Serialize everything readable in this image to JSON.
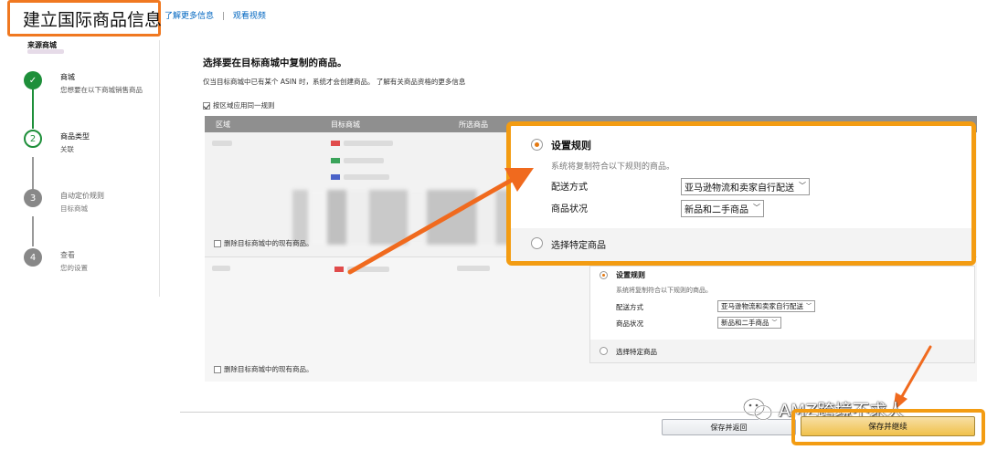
{
  "header": {
    "title": "建立国际商品信息",
    "link_more": "了解更多信息",
    "separator": "|",
    "link_video": "观看视频"
  },
  "sidebar": {
    "source_label": "来源商城",
    "steps": [
      {
        "number": "✓",
        "title": "商城",
        "subtitle": "您想要在以下商城销售商品",
        "state": "done"
      },
      {
        "number": "2",
        "title": "商品类型",
        "subtitle": "关联",
        "state": "active"
      },
      {
        "number": "3",
        "title": "自动定价规则",
        "subtitle": "目标商城",
        "state": "pending"
      },
      {
        "number": "4",
        "title": "查看",
        "subtitle": "您的设置",
        "state": "pending"
      }
    ]
  },
  "main": {
    "heading": "选择要在目标商城中复制的商品。",
    "description": "仅当目标商城中已有某个 ASIN 时，系统才会创建商品。 了解有关商品资格的更多信息",
    "apply_same_rule": "按区域应用同一规则",
    "columns": [
      "区域",
      "目标商城",
      "所选商品"
    ],
    "delete_listings_1": "删除目标商城中的现有商品。",
    "delete_listings_2": "删除目标商城中的现有商品。"
  },
  "rule_popup": {
    "option_rules": "设置规则",
    "rules_desc": "系统将复制符合以下规则的商品。",
    "shipping_label": "配送方式",
    "shipping_value": "亚马逊物流和卖家自行配送",
    "condition_label": "商品状况",
    "condition_value": "新品和二手商品",
    "option_specific": "选择特定商品"
  },
  "rule_panel": {
    "option_rules": "设置规则",
    "rules_desc": "系统将复制符合以下规则的商品。",
    "shipping_label": "配送方式",
    "shipping_value": "亚马逊物流和卖家自行配送",
    "condition_label": "商品状况",
    "condition_value": "新品和二手商品",
    "option_specific": "选择特定商品"
  },
  "footer": {
    "save_return": "保存并返回",
    "save_continue": "保存并继续"
  },
  "watermark": "AMZ跨境不求人",
  "colors": {
    "highlight": "#f39c12",
    "arrow": "#f06a1e",
    "done": "#1e8f3a",
    "link": "#0066c0",
    "table_header": "#8f8f8f",
    "primary_button": "#f0c14b"
  }
}
